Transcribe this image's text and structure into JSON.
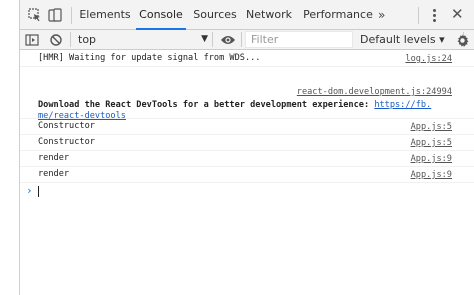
{
  "tabs": [
    {
      "label": "Elements"
    },
    {
      "label": "Console"
    },
    {
      "label": "Sources"
    },
    {
      "label": "Network"
    },
    {
      "label": "Performance"
    }
  ],
  "more_tabs_label": "»",
  "toolbar": {
    "context": "top",
    "filter_placeholder": "Filter",
    "levels_label": "Default levels ▾"
  },
  "console": {
    "messages": [
      {
        "text": "[HMR] Waiting for update signal from WDS...",
        "source": "log.js:24"
      },
      {
        "source": "react-dom.development.js:24994",
        "text_line1": "Download the React DevTools for a better development experience: ",
        "link_part1": "https://fb.",
        "link_part2": "me/react-devtools"
      },
      {
        "text": "Constructor",
        "source": "App.js:5"
      },
      {
        "text": "Constructor",
        "source": "App.js:5"
      },
      {
        "text": "render",
        "source": "App.js:9"
      },
      {
        "text": "render",
        "source": "App.js:9"
      }
    ],
    "prompt_symbol": "›"
  },
  "colors": {
    "accent": "#1a73e8",
    "toolbar_bg": "#f3f3f3",
    "link": "#1a5cc7"
  }
}
